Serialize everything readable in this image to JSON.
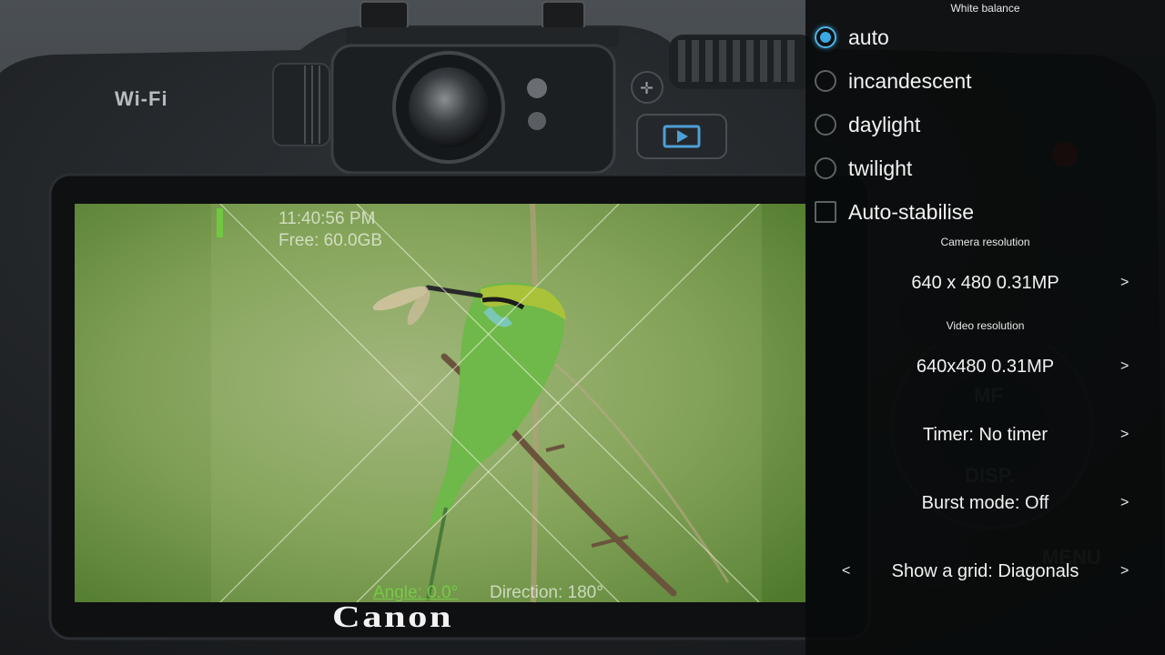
{
  "camera": {
    "wifi_label": "Wi-Fi",
    "brand": "Canon"
  },
  "viewfinder": {
    "time": "11:40:56 PM",
    "free_space": "Free: 60.0GB",
    "angle": "Angle: 0.0°",
    "direction": "Direction: 180°"
  },
  "settings": {
    "white_balance": {
      "title": "White balance",
      "options": [
        "auto",
        "incandescent",
        "daylight",
        "twilight"
      ],
      "selected": "auto"
    },
    "auto_stabilise": {
      "label": "Auto-stabilise",
      "checked": false
    },
    "camera_resolution": {
      "title": "Camera resolution",
      "value": "640 x 480 0.31MP",
      "next": ">"
    },
    "video_resolution": {
      "title": "Video resolution",
      "value": "640x480 0.31MP",
      "next": ">"
    },
    "timer": {
      "value": "Timer: No timer",
      "next": ">"
    },
    "burst_mode": {
      "value": "Burst mode: Off",
      "next": ">"
    },
    "grid": {
      "value": "Show a grid: Diagonals",
      "prev": "<",
      "next": ">"
    }
  },
  "colors": {
    "accent": "#3aa8e4",
    "panel_bg": "#080a0a",
    "angle_text": "#78d246"
  }
}
